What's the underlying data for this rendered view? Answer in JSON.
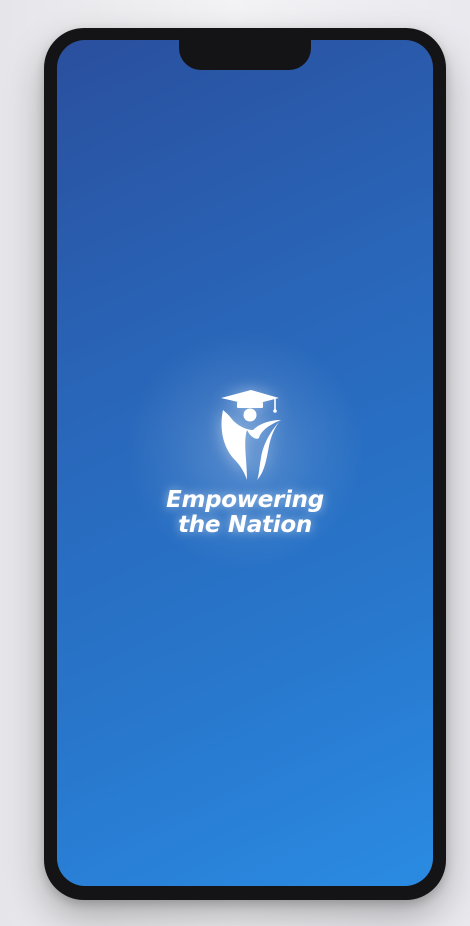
{
  "app": {
    "logo_icon": "graduate-person-icon",
    "tagline_line1": "Empowering",
    "tagline_line2": "the Nation"
  },
  "colors": {
    "gradient_start": "#2a4f9e",
    "gradient_end": "#2a8be2",
    "frame": "#141416",
    "logo": "#ffffff"
  }
}
